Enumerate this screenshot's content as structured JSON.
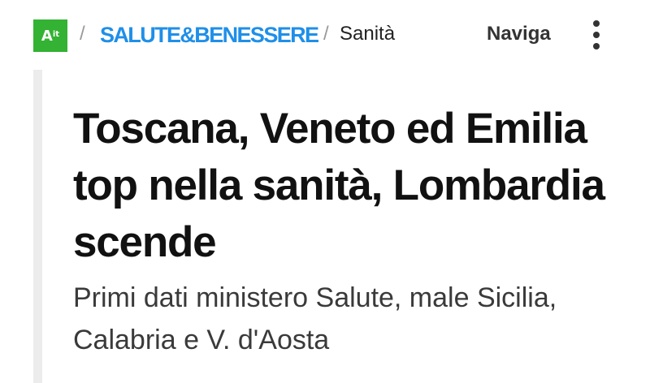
{
  "header": {
    "logo": {
      "main": "A",
      "suffix": "it"
    },
    "separator": "/",
    "section_label": "SALUTE&BENESSERE",
    "subsection_label": "Sanità",
    "nav_label": "Naviga",
    "menu_icon": "more-vertical-icon"
  },
  "article": {
    "headline": "Toscana, Veneto ed Emilia top nella sanità, Lombardia scende",
    "subtitle": "Primi dati ministero Salute, male Sicilia, Calabria e V. d'Aosta"
  },
  "colors": {
    "logo_background": "#34b233",
    "section_link": "#1f8fe8",
    "headline": "#111111",
    "subtitle": "#3a3a3a",
    "accent_bar": "#ececec"
  }
}
